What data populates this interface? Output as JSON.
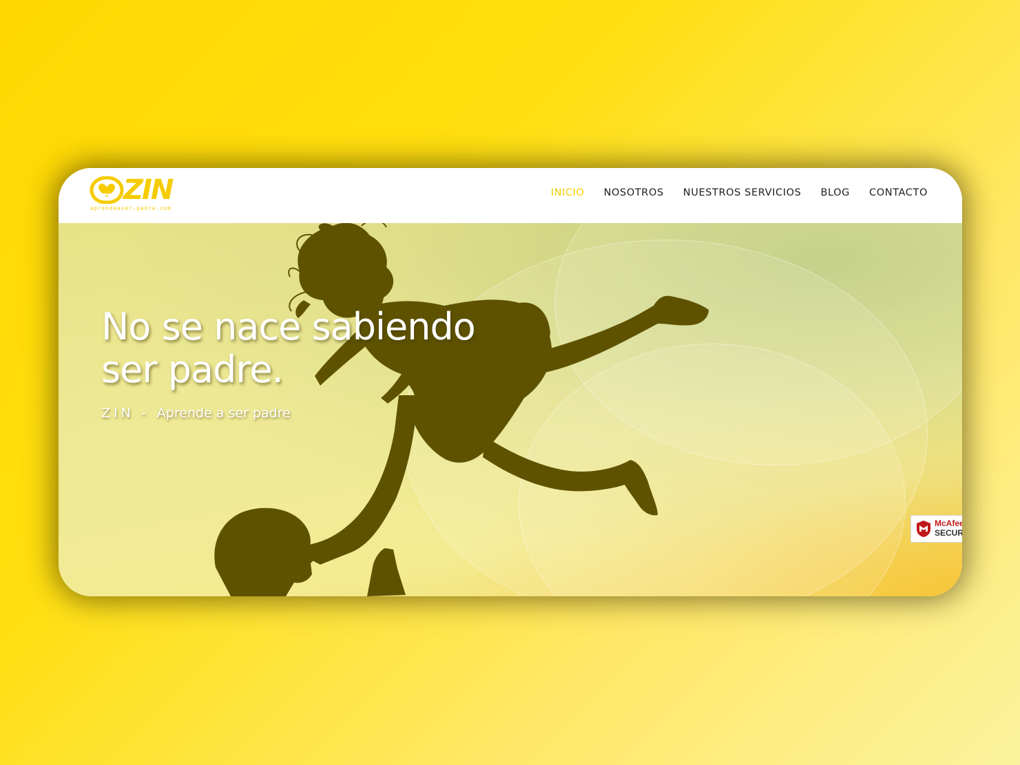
{
  "logo": {
    "wordmark": "ZIN",
    "tagline": "aprendeaser-padre.com",
    "brand_color": "#F5CC00"
  },
  "nav": {
    "items": [
      {
        "label": "INICIO",
        "active": true
      },
      {
        "label": "NOSOTROS",
        "active": false
      },
      {
        "label": "NUESTROS SERVICIOS",
        "active": false
      },
      {
        "label": "BLOG",
        "active": false
      },
      {
        "label": "CONTACTO",
        "active": false
      }
    ],
    "active_color": "#F5CC00"
  },
  "hero": {
    "title_line1": "No se nace sabiendo",
    "title_line2": "ser padre.",
    "subtitle_brand": "ZIN",
    "subtitle_separator": "-",
    "subtitle_text": "Aprende a ser padre",
    "silhouette_color": "#5E5200"
  },
  "badge": {
    "line1": "McAfee",
    "line2": "SECURE",
    "icon": "mcafee-shield-icon"
  }
}
